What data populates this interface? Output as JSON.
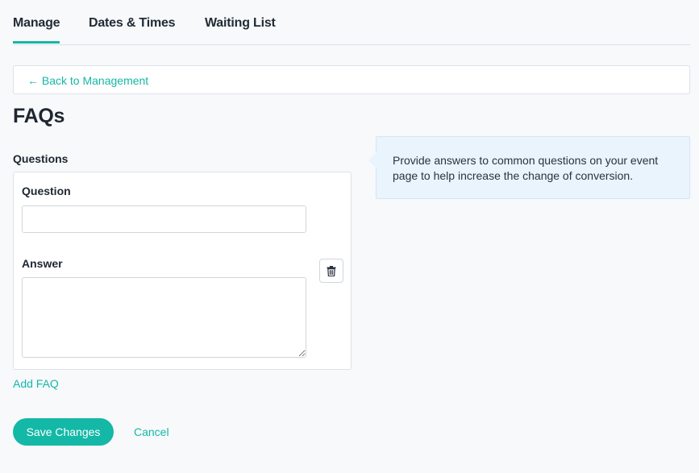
{
  "tabs": [
    {
      "label": "Manage",
      "active": true
    },
    {
      "label": "Dates & Times",
      "active": false
    },
    {
      "label": "Waiting List",
      "active": false
    }
  ],
  "back_link": {
    "arrow": "←",
    "label": "Back to Management"
  },
  "page_title": "FAQs",
  "questions_section": {
    "label": "Questions",
    "faq_items": [
      {
        "question_label": "Question",
        "question_value": "",
        "answer_label": "Answer",
        "answer_value": "",
        "delete_icon": "trash-icon"
      }
    ]
  },
  "add_faq_label": "Add FAQ",
  "actions": {
    "save_label": "Save Changes",
    "cancel_label": "Cancel"
  },
  "help_text": "Provide answers to common questions on your event page to help increase the change of conversion.",
  "colors": {
    "accent": "#14b8a6",
    "help_bg": "#eaf4fc",
    "page_bg": "#f7f9fb"
  }
}
